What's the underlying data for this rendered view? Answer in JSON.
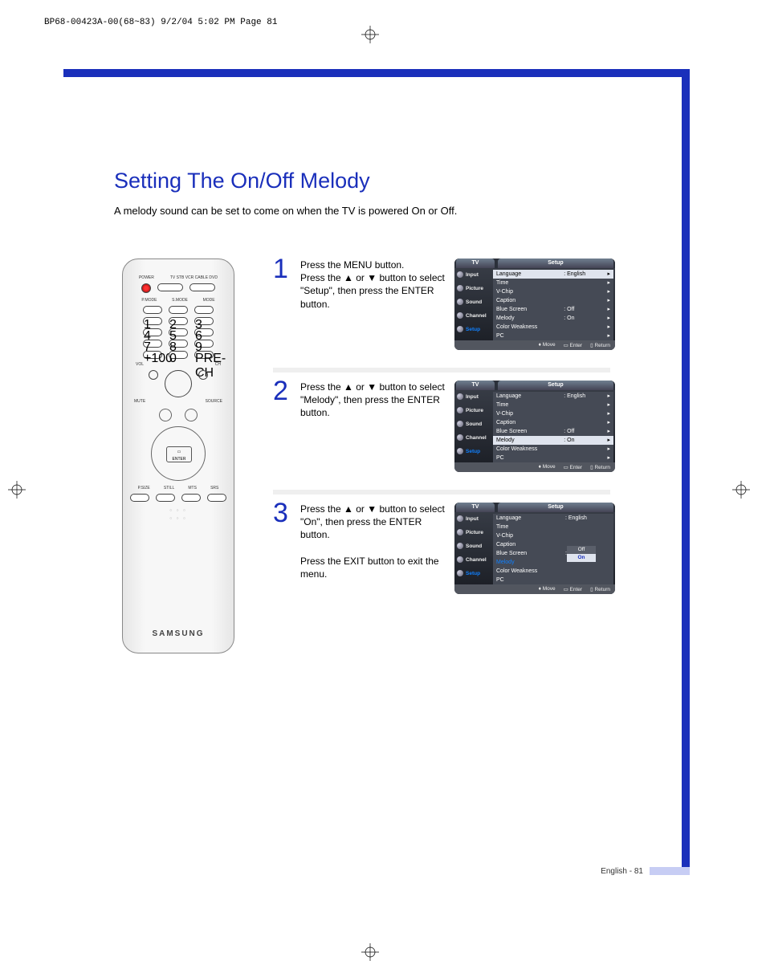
{
  "docMeta": "BP68-00423A-00(68~83)  9/2/04  5:02 PM  Page 81",
  "title": "Setting The On/Off Melody",
  "intro": "A melody sound can be set to come on when the TV is powered On or Off.",
  "remote": {
    "brand": "SAMSUNG"
  },
  "steps": [
    {
      "num": "1",
      "text": "Press the MENU button.\nPress the ▲ or ▼ button to select \"Setup\", then press the ENTER button."
    },
    {
      "num": "2",
      "text": "Press the ▲ or ▼ button to select \"Melody\", then press the ENTER button."
    },
    {
      "num": "3",
      "text": "Press the ▲ or ▼ button to select \"On\", then press the ENTER button.\n\nPress the EXIT button to exit the menu."
    }
  ],
  "osd": {
    "tv": "TV",
    "title": "Setup",
    "tabs": [
      "Input",
      "Picture",
      "Sound",
      "Channel",
      "Setup"
    ],
    "rows": [
      {
        "label": "Language",
        "val": ": English"
      },
      {
        "label": "Time",
        "val": ""
      },
      {
        "label": "V-Chip",
        "val": ""
      },
      {
        "label": "Caption",
        "val": ""
      },
      {
        "label": "Blue Screen",
        "val": ": Off"
      },
      {
        "label": "Melody",
        "val": ": On"
      },
      {
        "label": "Color Weakness",
        "val": ""
      },
      {
        "label": "PC",
        "val": ""
      }
    ],
    "melodyOptions": [
      "Off",
      "On"
    ],
    "footer": {
      "move": "Move",
      "enter": "Enter",
      "ret": "Return"
    }
  },
  "pageFooter": "English - 81"
}
